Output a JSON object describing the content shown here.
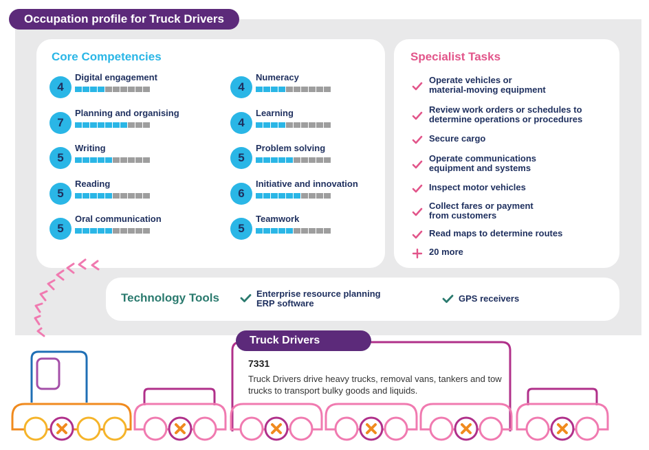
{
  "title": "Occupation profile for Truck Drivers",
  "core_competencies": {
    "heading": "Core Competencies",
    "items": [
      {
        "label": "Digital engagement",
        "level": 4
      },
      {
        "label": "Planning and organising",
        "level": 7
      },
      {
        "label": "Writing",
        "level": 5
      },
      {
        "label": "Reading",
        "level": 5
      },
      {
        "label": "Oral communication",
        "level": 5
      },
      {
        "label": "Numeracy",
        "level": 4
      },
      {
        "label": "Learning",
        "level": 4
      },
      {
        "label": "Problem solving",
        "level": 5
      },
      {
        "label": "Initiative and innovation",
        "level": 6
      },
      {
        "label": "Teamwork",
        "level": 5
      }
    ],
    "scale_max": 10
  },
  "specialist_tasks": {
    "heading": "Specialist Tasks",
    "items": [
      "Operate vehicles or\nmaterial-moving equipment",
      "Review work orders or schedules to\ndetermine operations or procedures",
      "Secure cargo",
      "Operate communications\nequipment and systems",
      "Inspect motor vehicles",
      "Collect fares or payment\nfrom customers",
      "Read maps to determine routes"
    ],
    "more": "20 more"
  },
  "technology_tools": {
    "heading": "Technology Tools",
    "items": [
      "Enterprise resource planning\nERP software",
      "GPS receivers"
    ]
  },
  "occupation": {
    "name": "Truck Drivers",
    "code": "7331",
    "description": "Truck Drivers drive heavy trucks, removal vans, tankers and tow trucks to transport bulky goods and liquids."
  },
  "colors": {
    "purple": "#5c2a7a",
    "blue": "#2ab6e6",
    "pink": "#e2558a",
    "teal": "#2a7a6e",
    "orange": "#f08a1e",
    "navy": "#1e2f5e"
  },
  "icons": [
    "check-icon",
    "plus-icon",
    "teal-check-icon",
    "wheel-cross-icon"
  ]
}
